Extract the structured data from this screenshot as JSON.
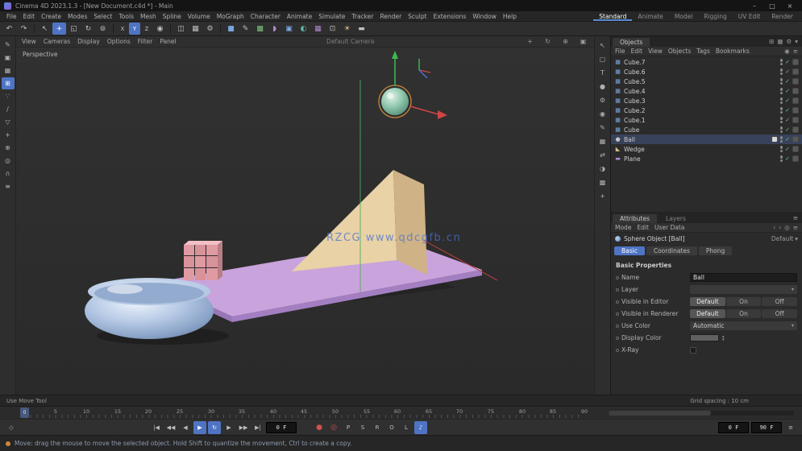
{
  "titlebar": {
    "title": "Cinema 4D 2023.1.3 - [New Document.c4d *] - Main",
    "minimize": "–",
    "maximize": "□",
    "close": "×"
  },
  "icons": {
    "chevron_down": "▾",
    "spin_up": "▴",
    "spin_down": "▾",
    "menu": "≡",
    "target": "◎",
    "search": "◉",
    "left": "‹",
    "right": "›",
    "grid": "⊞",
    "picture": "▦",
    "gear": "⚙",
    "pan": "+",
    "orbit": "↻",
    "zoom": "⊕",
    "maximize_view": "▣"
  },
  "colors": {
    "accent": "#4f74c4",
    "selection_ring": "#cf8a3c",
    "plane": "#c9a3dc",
    "wedge": "#e6cfa3",
    "bricks": "#e09aa2",
    "bowl": "#9fb6d6",
    "sphere": "#8cc4a9",
    "watermark": "#4a6fd4"
  },
  "menubar": {
    "items": [
      "File",
      "Edit",
      "Create",
      "Modes",
      "Select",
      "Tools",
      "Mesh",
      "Spline",
      "Volume",
      "MoGraph",
      "Character",
      "Animate",
      "Simulate",
      "Tracker",
      "Render",
      "Sculpt",
      "Extensions",
      "Window",
      "Help"
    ],
    "layout_tabs": [
      "Standard",
      "Animate",
      "Model",
      "Rigging",
      "UV Edit",
      "Render"
    ]
  },
  "toolbar": {
    "buttons": [
      {
        "glyph": "↶"
      },
      {
        "glyph": "↷"
      },
      {
        "glyph": "↖"
      },
      {
        "glyph": "+"
      },
      {
        "glyph": "◱"
      },
      {
        "glyph": "↻"
      },
      {
        "glyph": "⊚"
      },
      {
        "glyph": "X"
      },
      {
        "glyph": "Y"
      },
      {
        "glyph": "Z"
      },
      {
        "glyph": "◉"
      },
      {
        "glyph": "◫"
      },
      {
        "glyph": "▦"
      },
      {
        "glyph": "⚙"
      },
      {
        "glyph": "■"
      },
      {
        "glyph": "✎"
      },
      {
        "glyph": "▩"
      },
      {
        "glyph": "◗"
      },
      {
        "glyph": "▣"
      },
      {
        "glyph": "◐"
      },
      {
        "glyph": "▦"
      },
      {
        "glyph": "⊡"
      },
      {
        "glyph": "☀"
      },
      {
        "glyph": "▬"
      }
    ]
  },
  "left_palette": {
    "icons": [
      "✎",
      "▣",
      "▦",
      "⊞",
      "∵",
      "∕",
      "▽",
      "+",
      "⊕",
      "◎",
      "∩",
      "≡"
    ]
  },
  "mid_strip": {
    "icons": [
      "↖",
      "▢",
      "T",
      "●",
      "⚙",
      "◉",
      "✎",
      "▦",
      "⇄",
      "◑",
      "▩",
      "+"
    ]
  },
  "viewport": {
    "menu_items": [
      "View",
      "Cameras",
      "Display",
      "Options",
      "Filter",
      "Panel"
    ],
    "camera_label": "Default Camera",
    "view_label": "Perspective",
    "watermark": "RZCG  www.qdcgfb.cn"
  },
  "object_manager": {
    "tab": "Objects",
    "menu": [
      "File",
      "Edit",
      "View",
      "Objects",
      "Tags",
      "Bookmarks"
    ],
    "check_glyph": "✓",
    "rows": [
      {
        "name": "Cube.7",
        "icon": "▦"
      },
      {
        "name": "Cube.6",
        "icon": "▦"
      },
      {
        "name": "Cube.5",
        "icon": "▦"
      },
      {
        "name": "Cube.4",
        "icon": "▦"
      },
      {
        "name": "Cube.3",
        "icon": "▦"
      },
      {
        "name": "Cube.2",
        "icon": "▦"
      },
      {
        "name": "Cube.1",
        "icon": "▦"
      },
      {
        "name": "Cube",
        "icon": "▦"
      },
      {
        "name": "Ball",
        "icon": "●"
      },
      {
        "name": "Wedge",
        "icon": "◣"
      },
      {
        "name": "Plane",
        "icon": "▬"
      }
    ]
  },
  "attributes": {
    "panel_tabs": [
      "Attributes",
      "Layers"
    ],
    "menu": [
      "Mode",
      "Edit",
      "User Data"
    ],
    "object_title": "Sphere Object [Ball]",
    "preset_label": "Default",
    "tabs": [
      "Basic",
      "Coordinates",
      "Phong"
    ],
    "section": "Basic Properties",
    "fields": {
      "name_label": "Name",
      "name_value": "Ball",
      "layer_label": "Layer",
      "layer_value": "",
      "vis_editor_label": "Visible in Editor",
      "vis_renderer_label": "Visible in Renderer",
      "vis_options": [
        "Default",
        "On",
        "Off"
      ],
      "use_color_label": "Use Color",
      "use_color_value": "Automatic",
      "display_color_label": "Display Color",
      "xray_label": "X-Ray"
    }
  },
  "info_bar": {
    "left": "Use Move Tool",
    "right": "Grid spacing : 10 cm"
  },
  "timeline": {
    "ticks": [
      "0",
      "5",
      "10",
      "15",
      "20",
      "25",
      "30",
      "35",
      "40",
      "45",
      "50",
      "55",
      "60",
      "65",
      "70",
      "75",
      "80",
      "85",
      "90"
    ]
  },
  "transport": {
    "current_frame": "0",
    "marker": "◇",
    "to_start": "|◀",
    "prev_key": "◀◀",
    "prev_frame": "◀",
    "play": "▶",
    "next_frame": "▶",
    "next_key": "▶▶",
    "to_end": "▶|",
    "loop": "↻",
    "sound": "♪",
    "frame_value": "0 F",
    "record": "●",
    "autokey": "◎",
    "key_toggles": [
      "P",
      "S",
      "R",
      "O",
      "L"
    ],
    "start_value": "0 F",
    "end_value": "90 F"
  },
  "status_bar": {
    "message": "Move: drag the mouse to move the selected object. Hold Shift to quantize the movement, Ctrl to create a copy."
  }
}
